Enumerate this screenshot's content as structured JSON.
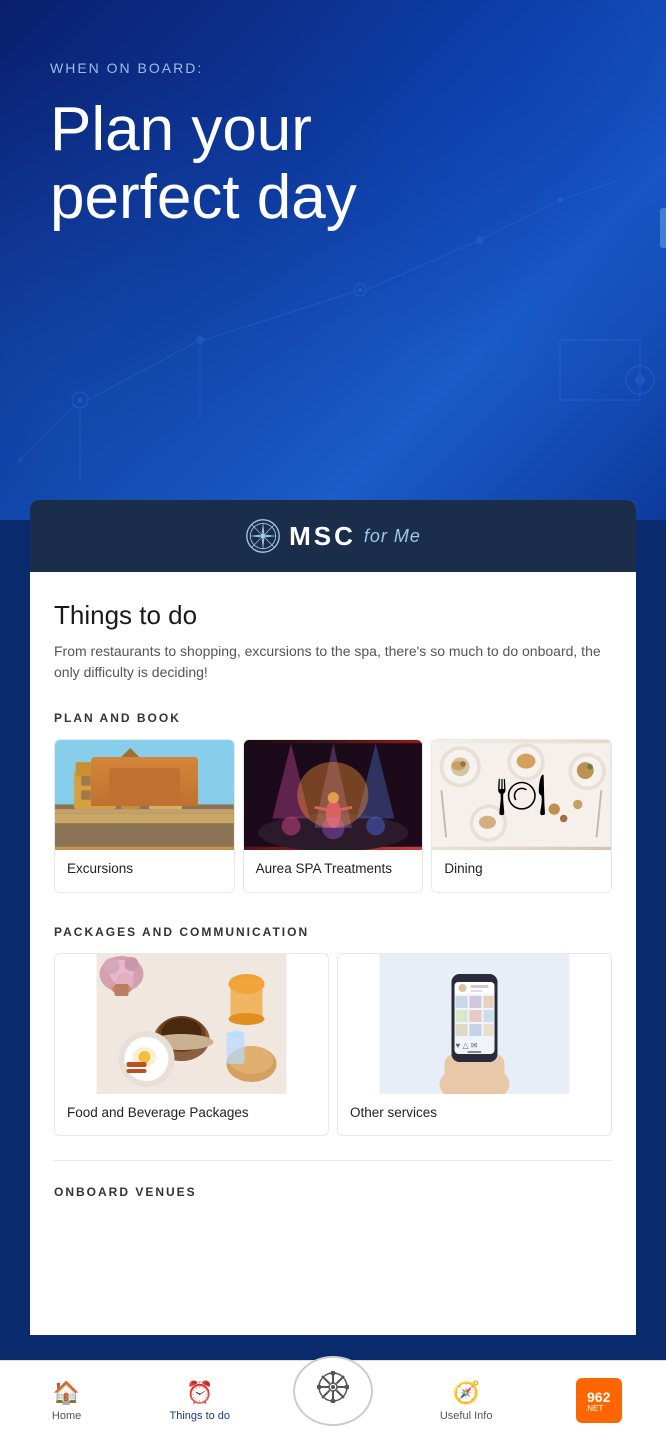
{
  "hero": {
    "label": "WHEN ON BOARD:",
    "title_line1": "Plan your",
    "title_line2": "perfect day"
  },
  "msc": {
    "logo_text": "MSC",
    "logo_sub": "for Me"
  },
  "things_to_do": {
    "heading": "Things to do",
    "description": "From restaurants to shopping, excursions to the spa, there's so much to do onboard, the only difficulty is deciding!"
  },
  "plan_and_book": {
    "label": "PLAN AND BOOK",
    "cards": [
      {
        "id": "excursions",
        "title": "Excursions"
      },
      {
        "id": "spa",
        "title": "Aurea SPA Treatments"
      },
      {
        "id": "dining",
        "title": "Dining"
      }
    ]
  },
  "packages": {
    "label": "PACKAGES AND COMMUNICATION",
    "cards": [
      {
        "id": "food-beverage",
        "title": "Food and Beverage Packages"
      },
      {
        "id": "other-services",
        "title": "Other services"
      }
    ]
  },
  "onboard_venues": {
    "label": "ONBOARD VENUES"
  },
  "nav": {
    "items": [
      {
        "id": "home",
        "label": "Home",
        "icon": "🏠",
        "active": false
      },
      {
        "id": "things-to-do",
        "label": "Things to do",
        "icon": "⏰",
        "active": true
      },
      {
        "id": "center",
        "label": "",
        "icon": "⚙",
        "active": false
      },
      {
        "id": "useful-info",
        "label": "Useful Info",
        "icon": "🧭",
        "active": false
      },
      {
        "id": "more",
        "label": "",
        "icon": "🔶",
        "active": false
      }
    ]
  }
}
